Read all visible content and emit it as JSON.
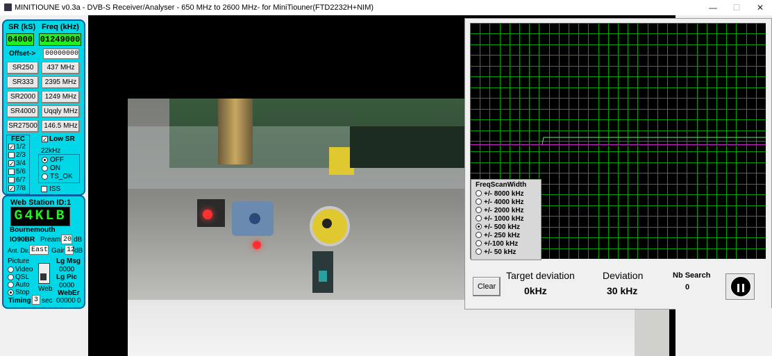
{
  "window": {
    "title": "MINITIOUNE v0.3a - DVB-S Receiver/Analyser - 650 MHz to 2600 MHz- for MiniTiouner(FTD2232H+NIM)",
    "minimize": "—",
    "maximize": "☐",
    "close": "✕"
  },
  "tuning": {
    "sr_label": "SR (kS)",
    "freq_label": "Freq (kHz)",
    "sr_value": "04000",
    "freq_value": "01249000",
    "offset_label": "Offset->",
    "offset_value": "00000000",
    "sr_buttons": [
      "SR250",
      "SR333",
      "SR2000",
      "SR4000",
      "SR27500"
    ],
    "freq_buttons": [
      "437 MHz",
      "2395 MHz",
      "1249 MHz",
      "Uqqly MHz",
      "146.5 MHz"
    ]
  },
  "fec": {
    "label": "FEC",
    "items": [
      {
        "label": "1/2",
        "checked": true
      },
      {
        "label": "2/3",
        "checked": false
      },
      {
        "label": "3/4",
        "checked": true
      },
      {
        "label": "5/6",
        "checked": false
      },
      {
        "label": "6/7",
        "checked": false
      },
      {
        "label": "7/8",
        "checked": true
      }
    ]
  },
  "low_sr": {
    "label": "Low SR",
    "checked": true
  },
  "khz22": {
    "label": "22kHz",
    "options": [
      {
        "label": "OFF",
        "selected": true
      },
      {
        "label": "ON",
        "selected": false
      },
      {
        "label": "TS_OK",
        "selected": false
      }
    ]
  },
  "iss": {
    "label": "ISS",
    "checked": false
  },
  "station": {
    "header": "Web Station ID:1",
    "callsign": "G4KLB",
    "location": "Bournemouth",
    "locator": "IO90BR",
    "preamp_label": "Preamp",
    "preamp_value": "20",
    "preamp_unit": "dB",
    "ant_dir_label": "Ant. Dir.",
    "ant_dir_value": "East",
    "gain_label": "Gain",
    "gain_value": "12",
    "gain_unit": "dB",
    "picture_label": "Picture",
    "picture_options": [
      {
        "label": "Video",
        "selected": false
      },
      {
        "label": "QSL",
        "selected": false
      },
      {
        "label": "Auto",
        "selected": false
      },
      {
        "label": "Stop",
        "selected": true
      }
    ],
    "web_label": "Web",
    "lg_msg_label": "Lg Msg",
    "lg_msg_value": "0000",
    "lg_pic_label": "Lg Pic",
    "lg_pic_value": "0000",
    "weber_label": "WebEr",
    "weber_value": "00000",
    "weber_extra": "0",
    "timing_label": "Timing",
    "timing_value": "3",
    "timing_unit": "sec"
  },
  "scan": {
    "header": "FreqScanWidth",
    "options": [
      {
        "label": "+/- 8000 kHz",
        "selected": false
      },
      {
        "label": "+/- 4000 kHz",
        "selected": false
      },
      {
        "label": "+/- 2000 kHz",
        "selected": false
      },
      {
        "label": "+/- 1000 kHz",
        "selected": false
      },
      {
        "label": "+/- 500 kHz",
        "selected": true
      },
      {
        "label": "+/- 250 kHz",
        "selected": false
      },
      {
        "label": "+/-100 kHz",
        "selected": false
      },
      {
        "label": "+/- 50 kHz",
        "selected": false
      }
    ]
  },
  "results": {
    "clear_label": "Clear",
    "target_deviation_label": "Target deviation",
    "target_deviation_value": "0kHz",
    "deviation_label": "Deviation",
    "deviation_value": "30 kHz",
    "nb_search_label": "Nb Search",
    "nb_search_value": "0"
  },
  "colors": {
    "panel": "#00d8e8",
    "lcd_green": "#22ee22",
    "grid_green": "#00a000",
    "marker_magenta": "#cc22cc"
  }
}
